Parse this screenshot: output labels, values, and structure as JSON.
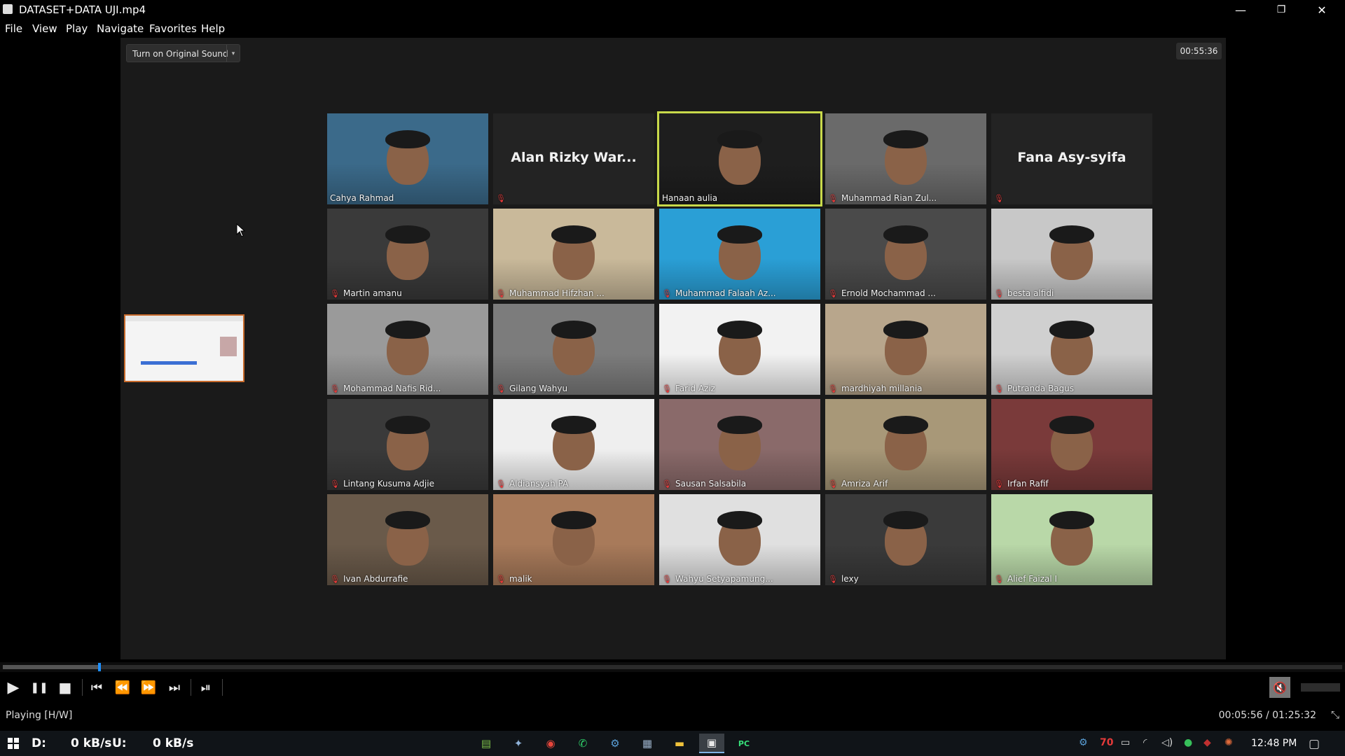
{
  "window": {
    "title": "DATASET+DATA UJI.mp4",
    "minimize": "—",
    "restore": "❐",
    "close": "✕"
  },
  "menu": [
    "File",
    "View",
    "Play",
    "Navigate",
    "Favorites",
    "Help"
  ],
  "zoom": {
    "sound_button": "Turn on Original Sound",
    "dropdown_glyph": "▾",
    "meeting_timer": "00:55:36"
  },
  "participants": [
    {
      "name": "Cahya Rahmad",
      "muted": false,
      "video": true
    },
    {
      "name": "Alan Rizky War...",
      "muted": true,
      "video": false
    },
    {
      "name": "Hanaan aulia",
      "muted": false,
      "video": true,
      "speaking": true
    },
    {
      "name": "Muhammad Rian Zul...",
      "muted": true,
      "video": true
    },
    {
      "name": "Fana Asy-syifa",
      "muted": true,
      "video": false
    },
    {
      "name": "Martin amanu",
      "muted": true,
      "video": true
    },
    {
      "name": "Muhammad Hifzhan ...",
      "muted": true,
      "video": true
    },
    {
      "name": "Muhammad Falaah Az...",
      "muted": true,
      "video": true
    },
    {
      "name": "Ernold Mochammad ...",
      "muted": true,
      "video": true
    },
    {
      "name": "besta alfidi",
      "muted": true,
      "video": true
    },
    {
      "name": "Mohammad Nafis Rid...",
      "muted": true,
      "video": true
    },
    {
      "name": "Gilang Wahyu",
      "muted": true,
      "video": true
    },
    {
      "name": "Farid Aziz",
      "muted": true,
      "video": true
    },
    {
      "name": "mardhiyah millania",
      "muted": true,
      "video": true
    },
    {
      "name": "Putranda Bagus",
      "muted": true,
      "video": true
    },
    {
      "name": "Lintang Kusuma Adjie",
      "muted": true,
      "video": true
    },
    {
      "name": "Aldiansyah PA",
      "muted": true,
      "video": true
    },
    {
      "name": "Sausan Salsabila",
      "muted": true,
      "video": true
    },
    {
      "name": "Amriza Arif",
      "muted": true,
      "video": true
    },
    {
      "name": "Irfan Rafif",
      "muted": true,
      "video": true
    },
    {
      "name": "Ivan Abdurrafie",
      "muted": true,
      "video": true
    },
    {
      "name": "malik",
      "muted": true,
      "video": true
    },
    {
      "name": "Wahyu Setyapamung...",
      "muted": true,
      "video": true
    },
    {
      "name": "lexy",
      "muted": true,
      "video": true
    },
    {
      "name": "Alief Faizal I",
      "muted": true,
      "video": true
    }
  ],
  "tile_colors": [
    "#3b6a8a",
    "#262626",
    "#1e1e1e",
    "#6a6a6a",
    "#262626",
    "#3a3a3a",
    "#c9b99a",
    "#2a9fd6",
    "#4a4a4a",
    "#c8c8c8",
    "#9a9a9a",
    "#7c7c7c",
    "#f2f2f2",
    "#b8a68c",
    "#d0d0d0",
    "#3a3a3a",
    "#efefef",
    "#8a6a6a",
    "#a89878",
    "#7a3a3a",
    "#6a5a4a",
    "#a87a5a",
    "#e0e0e0",
    "#3a3a3a",
    "#b9d8a8"
  ],
  "player": {
    "progress": 0.0711,
    "status": "Playing [H/W]",
    "time": "00:05:56 / 01:25:32",
    "buttons": {
      "play": "▶",
      "pause": "❚❚",
      "stop": "■",
      "prev": "⏮",
      "rewind": "⏪",
      "forward": "⏩",
      "next": "⏭",
      "frame_step": "⏯"
    },
    "volume_icon": "🔇",
    "fullscreen_icon": "⤡"
  },
  "taskbar": {
    "down_label": "D:",
    "down_rate": "0 kB/s",
    "up_label": "U:",
    "up_rate": "0 kB/s",
    "apps": [
      {
        "icon": "notepad-icon",
        "glyph": "▤",
        "color": "#7ec24a"
      },
      {
        "icon": "bird-icon",
        "glyph": "✦",
        "color": "#8fb2d8"
      },
      {
        "icon": "chrome-icon",
        "glyph": "◉",
        "color": "#e8463b"
      },
      {
        "icon": "whatsapp-icon",
        "glyph": "✆",
        "color": "#2fd16a"
      },
      {
        "icon": "steam-icon",
        "glyph": "⚙",
        "color": "#5aa0d8"
      },
      {
        "icon": "photos-icon",
        "glyph": "▦",
        "color": "#9ab0c8"
      },
      {
        "icon": "explorer-icon",
        "glyph": "▬",
        "color": "#f0c23a"
      },
      {
        "icon": "media-player-icon",
        "glyph": "▣",
        "color": "#e8e8e8",
        "active": true
      },
      {
        "icon": "pycharm-icon",
        "glyph": "PC",
        "color": "#37e07a"
      }
    ],
    "tray": {
      "temp": "70",
      "clock": "12:48 PM"
    }
  }
}
